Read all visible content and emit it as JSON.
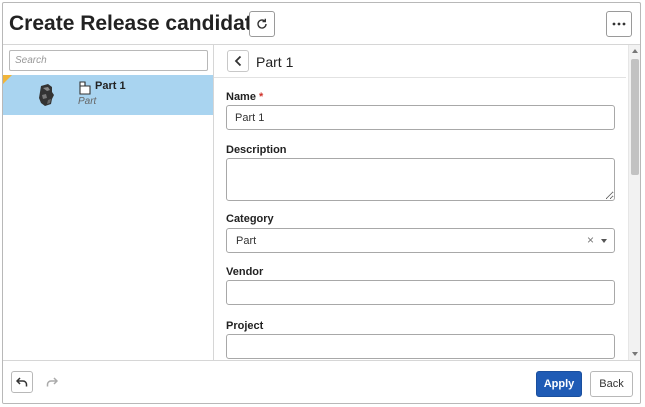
{
  "dialog": {
    "title": "Create Release candidate"
  },
  "icons": {
    "refresh": "refresh-icon",
    "more": "more-horizontal-icon",
    "back": "chevron-left-icon",
    "undo": "undo-icon",
    "redo": "redo-icon",
    "part_type": "part-icon",
    "clear": "clear-icon",
    "caret": "caret-down-icon"
  },
  "search": {
    "placeholder": "Search"
  },
  "tree": {
    "items": [
      {
        "name": "Part 1",
        "type": "Part"
      }
    ]
  },
  "detail": {
    "title": "Part 1",
    "fields": {
      "name": {
        "label": "Name",
        "required_mark": "*",
        "value": "Part 1"
      },
      "description": {
        "label": "Description",
        "value": ""
      },
      "category": {
        "label": "Category",
        "value": "Part",
        "clear": "×"
      },
      "vendor": {
        "label": "Vendor",
        "value": ""
      },
      "project": {
        "label": "Project",
        "value": ""
      }
    }
  },
  "footer": {
    "apply_label": "Apply",
    "back_label": "Back"
  },
  "colors": {
    "primary": "#1f5bb5",
    "selected_row": "#a9d4f0",
    "flag": "#f1b53a",
    "required": "#d0342c"
  }
}
